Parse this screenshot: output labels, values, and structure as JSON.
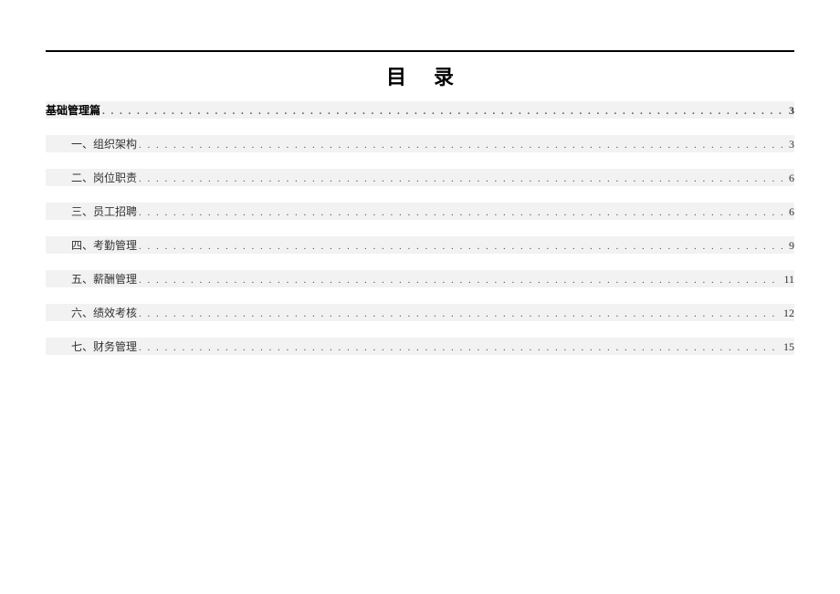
{
  "title": "目录",
  "toc": [
    {
      "label": "基础管理篇",
      "page": "3",
      "level": "section"
    },
    {
      "label": "一、组织架构",
      "page": "3",
      "level": "subsection"
    },
    {
      "label": "二、岗位职责",
      "page": "6",
      "level": "subsection"
    },
    {
      "label": "三、员工招聘",
      "page": "6",
      "level": "subsection"
    },
    {
      "label": "四、考勤管理",
      "page": "9",
      "level": "subsection"
    },
    {
      "label": "五、薪酬管理",
      "page": "11",
      "level": "subsection"
    },
    {
      "label": "六、绩效考核",
      "page": "12",
      "level": "subsection"
    },
    {
      "label": "七、财务管理",
      "page": "15",
      "level": "subsection"
    }
  ],
  "leader": ". . . . . . . . . . . . . . . . . . . . . . . . . . . . . . . . . . . . . . . . . . . . . . . . . . . . . . . . . . . . . . . . . . . . . . . . . . . . . . . . . . . . . . . . . . . . . . . . . . . . . . . . . . . . . . . . . . . . . . . . . . . . . . . . . . . . . . . . . . . . . . . . . . . . . . . . . . . . . . . . . . . . . . . . . . . . . . . . . . . . . . . . . . . . . . . . . . . . . . . ."
}
